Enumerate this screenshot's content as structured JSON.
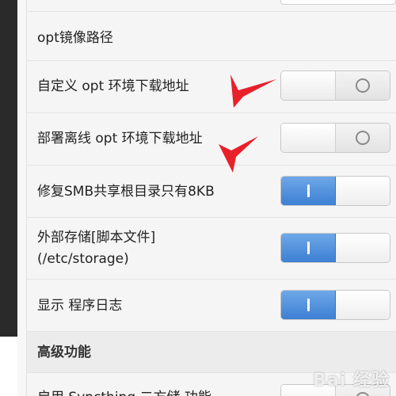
{
  "settings": {
    "opt_mirror_path": {
      "label": "opt镜像路径"
    },
    "custom_opt_download": {
      "label": "自定义 opt 环境下载地址",
      "state": "off"
    },
    "deploy_offline_opt": {
      "label": "部署离线 opt 环境下载地址",
      "state": "off"
    },
    "fix_smb_share": {
      "label": "修复SMB共享根目录只有8KB",
      "state": "on"
    },
    "external_storage": {
      "label_line1": "外部存储[脚本文件]",
      "label_line2": "(/etc/storage)",
      "state": "on"
    },
    "show_program_log": {
      "label": "显示 程序日志",
      "state": "on"
    },
    "advanced_section": {
      "label": "高级功能"
    },
    "syncthing_row": {
      "label": "启用 Syncthing 二方储 功能"
    }
  },
  "watermark": {
    "text": "Bai 经验"
  },
  "colors": {
    "accent": "#3d7fd3",
    "annotation_arrow": "#e8202a"
  }
}
